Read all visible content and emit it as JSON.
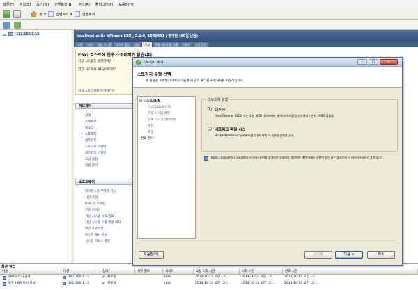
{
  "menu": [
    "파일(F)",
    "편집(E)",
    "보기(W)",
    "인벤토리(N)",
    "관리(A)",
    "플러그인(P)",
    "도움말(H)"
  ],
  "nav": {
    "home": "홈",
    "inventory1": "인벤토리",
    "inventory2": "인벤토리"
  },
  "tree": {
    "host": "192.168.1.15"
  },
  "host_header": {
    "title": "localhost.antis VMware ESXi, 5.1.0, 1065491 | 평가판 (60일 남음)"
  },
  "tabs": [
    "시작",
    "요약",
    "가상 시스템",
    "리소스 할당",
    "성능",
    "구성",
    "로컬 사용자 및 그룹",
    "이벤트",
    "사용 권한"
  ],
  "warning": {
    "title": "ESXi 호스트에 연구 스토리지가 없습니다.",
    "line1": "가상 시스템을 설명하려면 ",
    "line2": "참고: iSCSI나 NFS(네트워크",
    "link": "지금 스토리지를 추가하려면"
  },
  "hardware": {
    "title": "하드웨어",
    "items": [
      "상태",
      "프로세서",
      "메모리",
      "스토리지",
      "네트워킹",
      "스토리지 어댑터",
      "네트워크 어댑터",
      "고급 설정",
      "전원 관리"
    ]
  },
  "software": {
    "title": "소프트웨어",
    "items": [
      "라이센스가 부여된 기능",
      "시간 구성",
      "DNS 및 라우팅",
      "인증 서비스",
      "가상 시스템 시작/종료",
      "가상 시스템 스왑 파일 위치",
      "보안 프로파일",
      "호스트 캐시 구성",
      "시스템 리소스 할당"
    ]
  },
  "dialog": {
    "title": "스토리지 추가",
    "header_title": "스토리지 유형 선택",
    "header_desc": "새 볼륨을 포맷할지 네트워크를 통해 공유 폴더를 사용하지를 지정하십시오.",
    "steps": [
      {
        "label": "디스크/LUN",
        "main": true
      },
      {
        "label": "디스크/LUN 선택",
        "main": false
      },
      {
        "label": "파일 시스템 버전",
        "main": false
      },
      {
        "label": "현재 디스크 레이아웃",
        "main": false
      },
      {
        "label": "속성",
        "main": false
      },
      {
        "label": "포맷",
        "main": false
      },
      {
        "label": "완료 준비",
        "main": true
      }
    ],
    "group_label": "스토리지 유형",
    "disk_label": "디스크",
    "disk_desc": "Fibre Channel, iSCSI 또는 로컬 SCSI 디스크에서 데이터스토어를 생성하거나 기존의 VMFS 볼륨을",
    "nfs_label": "네트워크 파일 시스",
    "nfs_desc": "NFS(Network File System)를 생성하려면 이 옵션을 선택합니다.",
    "info": "Fibre Channel이나 iSCSI에서 데이터스토어를 추가하면 스토리지 미디어에 대한 액세스 권한이 있는 모든 호스트에 이 데이터스토어가 추가됩니다.",
    "help": "도움말(H)",
    "back": "≤뒤로",
    "next": "다음 ≥",
    "cancel": "취소"
  },
  "recent": {
    "title": "최근 작업",
    "headers": [
      "이름",
      "대상",
      "상태",
      "세부 정보",
      "시작자",
      "요청 시작 시간",
      "시작 시간",
      "완료 시간"
    ],
    "rows": [
      {
        "name": "VMFS 다시 검사",
        "target": "192.168.1.15",
        "status": "완료됨",
        "initiator": "root",
        "requested": "2013-10-15 오전 12:...",
        "start": "2013-10-15 오전 12:...",
        "complete": "2013-10-15 오전 12:..."
      },
      {
        "name": "모든 HBA 다시 검사",
        "target": "192.168.1.15",
        "status": "완료됨",
        "initiator": "root",
        "requested": "2013-10-15 오전 12:...",
        "start": "2013-10-15 오전 12:...",
        "complete": "2013-10-15 오전 12:..."
      }
    ]
  },
  "colors": {
    "accent": "#35507a",
    "link": "#1f3a7a",
    "ok": "#2f8a1e"
  }
}
